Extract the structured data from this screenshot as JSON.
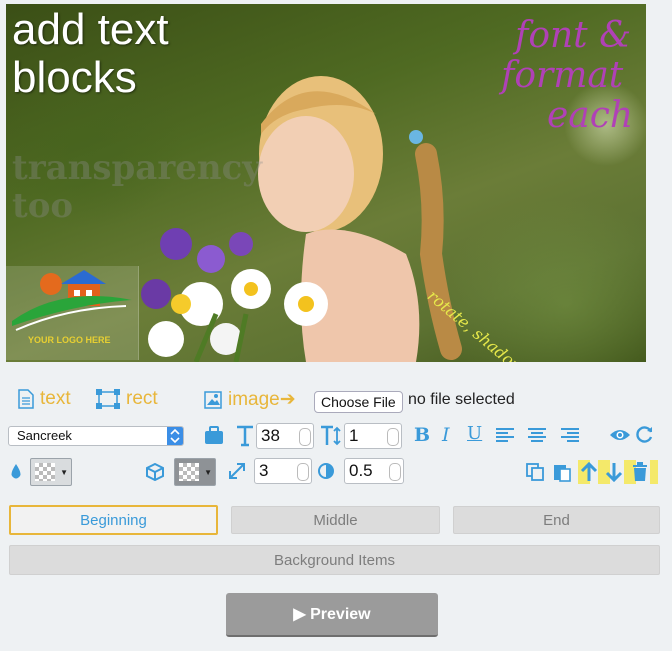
{
  "canvas": {
    "texts": {
      "add_line1": "add text",
      "add_line2": "blocks",
      "font_line1": "font &",
      "font_line2": "format",
      "font_line3": "each",
      "transparency_line1": "transparency",
      "transparency_line2": "too",
      "rotate": "rotate, shadow & color"
    },
    "logo_text": "YOUR LOGO HERE"
  },
  "toolbar": {
    "text_label": "text",
    "rect_label": "rect",
    "image_label": "image",
    "image_arrow": "➔",
    "choose_file_label": "Choose File",
    "file_status": "no file selected",
    "font_family_value": "Sancreek",
    "font_size_value": "38",
    "line_height_value": "1",
    "bold_label": "B",
    "italic_label": "I",
    "underline_label": "U",
    "stroke_width_value": "3",
    "opacity_value": "0.5"
  },
  "timeline": {
    "beginning": "Beginning",
    "middle": "Middle",
    "end": "End",
    "background_items": "Background Items",
    "preview": "▶ Preview"
  },
  "colors": {
    "accent": "#3a9ad9",
    "label_gold": "#e8b63a",
    "highlight": "#f4e96a"
  }
}
